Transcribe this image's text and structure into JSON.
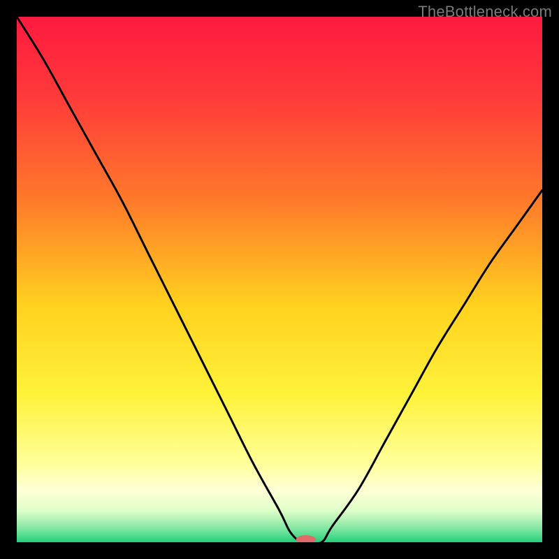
{
  "watermark": "TheBottleneck.com",
  "chart_data": {
    "type": "line",
    "title": "",
    "xlabel": "",
    "ylabel": "",
    "xlim": [
      0,
      100
    ],
    "ylim": [
      0,
      100
    ],
    "x": [
      0,
      5,
      10,
      15,
      20,
      25,
      30,
      35,
      40,
      45,
      50,
      52,
      54,
      55,
      58,
      60,
      65,
      70,
      75,
      80,
      85,
      90,
      95,
      100
    ],
    "values": [
      100,
      92,
      83,
      74,
      65,
      55,
      45,
      35,
      25,
      15,
      6,
      2,
      0,
      0,
      0,
      3,
      10,
      19,
      28,
      37,
      45,
      53,
      60,
      67
    ],
    "minimum_x_range": [
      52,
      58
    ],
    "minimum_y": 0,
    "gradient_stops": [
      {
        "offset": 0.0,
        "color": "#ff1a3f"
      },
      {
        "offset": 0.15,
        "color": "#ff3a3a"
      },
      {
        "offset": 0.35,
        "color": "#ff7a2a"
      },
      {
        "offset": 0.55,
        "color": "#ffd21f"
      },
      {
        "offset": 0.72,
        "color": "#fff23a"
      },
      {
        "offset": 0.85,
        "color": "#ffff9a"
      },
      {
        "offset": 0.9,
        "color": "#ffffd6"
      },
      {
        "offset": 0.94,
        "color": "#dfffc8"
      },
      {
        "offset": 0.97,
        "color": "#8fe9a8"
      },
      {
        "offset": 1.0,
        "color": "#24d07a"
      }
    ],
    "marker": {
      "color": "#e06a6a",
      "rx": 14,
      "ry": 6
    }
  }
}
